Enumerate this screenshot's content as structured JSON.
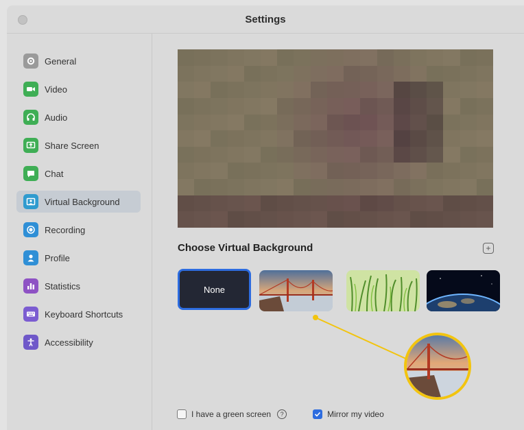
{
  "window": {
    "title": "Settings"
  },
  "sidebar": {
    "items": [
      {
        "label": "General",
        "icon": "gear-icon",
        "color": "#9a9a9a",
        "active": false
      },
      {
        "label": "Video",
        "icon": "video-icon",
        "color": "#3fae55",
        "active": false
      },
      {
        "label": "Audio",
        "icon": "headphones-icon",
        "color": "#3fae55",
        "active": false
      },
      {
        "label": "Share Screen",
        "icon": "share-screen-icon",
        "color": "#3fae55",
        "active": false
      },
      {
        "label": "Chat",
        "icon": "chat-icon",
        "color": "#3fae55",
        "active": false
      },
      {
        "label": "Virtual Background",
        "icon": "virtual-background-icon",
        "color": "#2f9bcf",
        "active": true
      },
      {
        "label": "Recording",
        "icon": "recording-icon",
        "color": "#2f8fd6",
        "active": false
      },
      {
        "label": "Profile",
        "icon": "profile-icon",
        "color": "#2f8fd6",
        "active": false
      },
      {
        "label": "Statistics",
        "icon": "statistics-icon",
        "color": "#8e52c4",
        "active": false
      },
      {
        "label": "Keyboard Shortcuts",
        "icon": "keyboard-icon",
        "color": "#7b5cd1",
        "active": false
      },
      {
        "label": "Accessibility",
        "icon": "accessibility-icon",
        "color": "#6f58c9",
        "active": false
      }
    ]
  },
  "main": {
    "section_title": "Choose Virtual Background",
    "add_icon": "plus-icon",
    "backgrounds": [
      {
        "label": "None",
        "selected": true
      },
      {
        "label": "",
        "image": "golden-gate-bridge"
      },
      {
        "label": "",
        "image": "grass"
      },
      {
        "label": "",
        "image": "earth-from-space"
      }
    ],
    "options": {
      "green_screen_label": "I have a green screen",
      "green_screen_checked": false,
      "mirror_label": "Mirror my video",
      "mirror_checked": true
    }
  },
  "colors": {
    "accent": "#2d6cdf",
    "highlight": "#f2c40f"
  }
}
